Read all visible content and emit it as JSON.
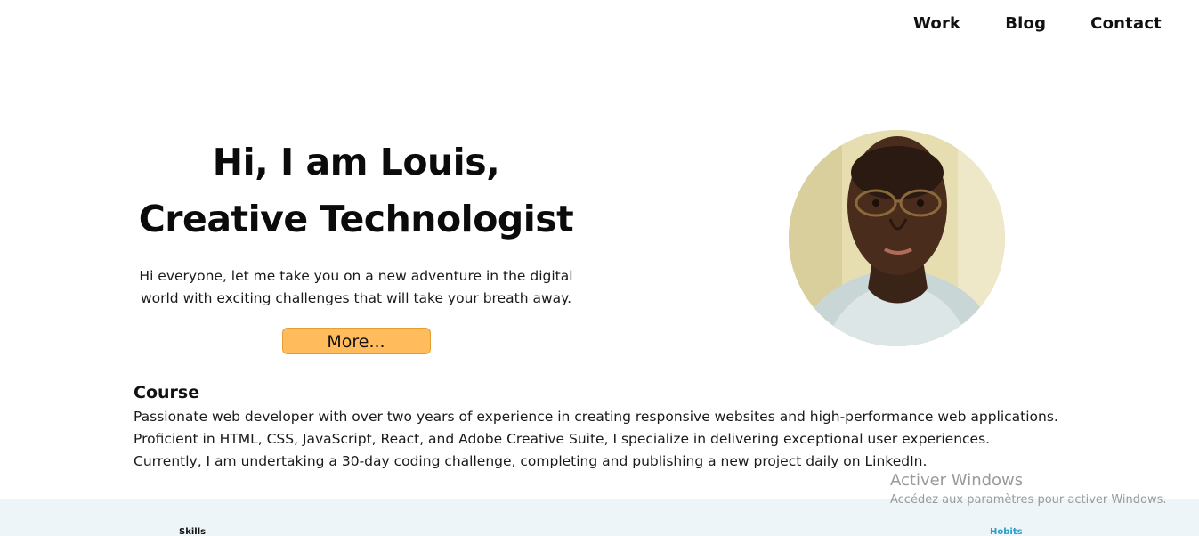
{
  "nav": {
    "items": [
      {
        "label": "Work"
      },
      {
        "label": "Blog"
      },
      {
        "label": "Contact"
      }
    ]
  },
  "hero": {
    "title_line1": "Hi, I am Louis,",
    "title_line2": "Creative Technologist",
    "subtitle": "Hi everyone, let me take you on a new adventure in the digital world with exciting challenges that will take your breath away.",
    "button_label": "More..."
  },
  "course": {
    "title": "Course",
    "body": "Passionate web developer with over two years of experience in creating responsive websites and high-performance web applications. Proficient in HTML, CSS, JavaScript, React, and Adobe Creative Suite, I specialize in delivering exceptional user experiences. Currently, I am undertaking a 30-day coding challenge, completing and publishing a new project daily on LinkedIn."
  },
  "sections": {
    "skills_label": "Skills",
    "hobits_label": "Hobits"
  },
  "watermark": {
    "title": "Activer Windows",
    "subtitle": "Accédez aux paramètres pour activer Windows."
  },
  "colors": {
    "button_bg": "#ffbb5c",
    "band_bg": "#eef5f8",
    "hobits_accent": "#2b9fc9"
  }
}
